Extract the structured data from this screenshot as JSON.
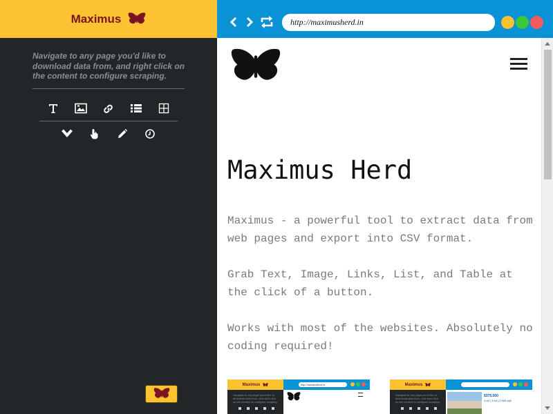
{
  "extension": {
    "title": "Maximus",
    "instructions": "Navigate to any page you'd like to download data from, and right click on the content to configure scraping.",
    "tools_row1": [
      "text-icon",
      "image-icon",
      "link-icon",
      "list-icon",
      "table-icon"
    ],
    "tools_row2": [
      "chevron-down-icon",
      "hand-pointer-icon",
      "pencil-icon",
      "clock-icon"
    ],
    "brand_yellow": "#fdc231",
    "brand_dark": "#232629",
    "brand_maroon": "#7a1420"
  },
  "browser": {
    "url": "http://maximusherd.in",
    "toolbar_color": "#0a92d6",
    "window_dots": [
      "#fdc231",
      "#3cc83c",
      "#f25c5c"
    ]
  },
  "page": {
    "title": "Maximus Herd",
    "paragraphs": [
      "Maximus - a powerful tool to extract data from web pages and export into CSV format.",
      "Grab Text, Image, Links, List, and Table at the click of a button.",
      "Works with most of the websites. Absolutely no coding required!"
    ],
    "thumbnail1": {
      "title": "Maximus",
      "url": "http://maximusherd.in"
    },
    "thumbnail2": {
      "title": "Maximus",
      "price": "$375,000",
      "address": "4 bd | 3 ba | 2,960 sqft"
    }
  }
}
